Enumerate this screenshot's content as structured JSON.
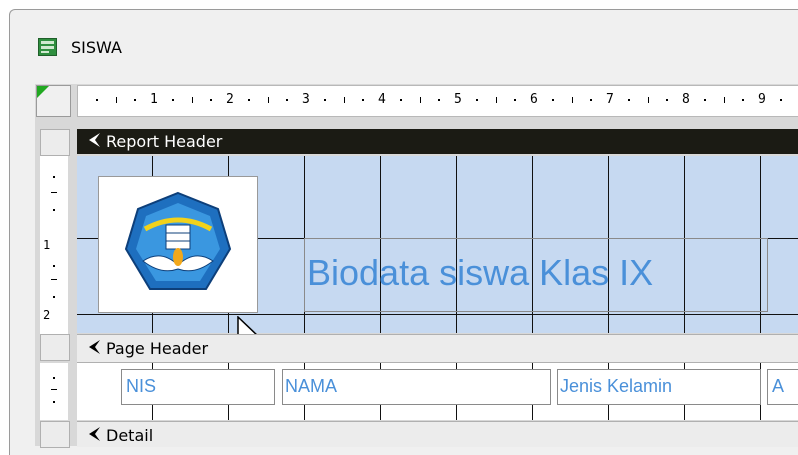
{
  "window": {
    "title": "SISWA",
    "icon": "form-icon"
  },
  "ruler": {
    "horizontal_numbers": [
      "1",
      "2",
      "3",
      "4",
      "5",
      "6",
      "7",
      "8",
      "9"
    ],
    "vertical_marks": [
      "1",
      "2"
    ]
  },
  "sections": {
    "report_header": "Report Header",
    "page_header": "Page Header",
    "detail": "Detail"
  },
  "report_header": {
    "title_label": "Biodata siswa Klas IX",
    "logo": "tut-wuri-handayani-logo"
  },
  "page_header": {
    "labels": [
      "NIS",
      "NAMA",
      "Jenis Kelamin",
      "A"
    ]
  },
  "colors": {
    "section_bar": "#1b1b14",
    "grid_background": "#c6d9f1",
    "label_text": "#4a90d9",
    "page_header_bar": "#ececec"
  }
}
